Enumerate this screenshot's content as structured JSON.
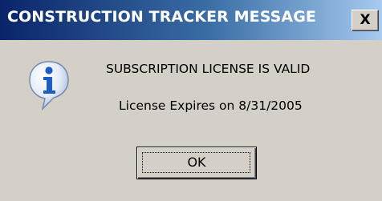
{
  "window": {
    "title": "CONSTRUCTION TRACKER MESSAGE",
    "close_label": "X"
  },
  "message": {
    "icon": "information-icon",
    "main_text": "SUBSCRIPTION LICENSE IS VALID",
    "sub_text": "License Expires on 8/31/2005"
  },
  "buttons": {
    "ok_label": "OK"
  },
  "colors": {
    "titlebar_start": "#0a246a",
    "titlebar_end": "#a6caf0",
    "dialog_background": "#d4d0c8",
    "icon_blue": "#1c5cc4"
  }
}
